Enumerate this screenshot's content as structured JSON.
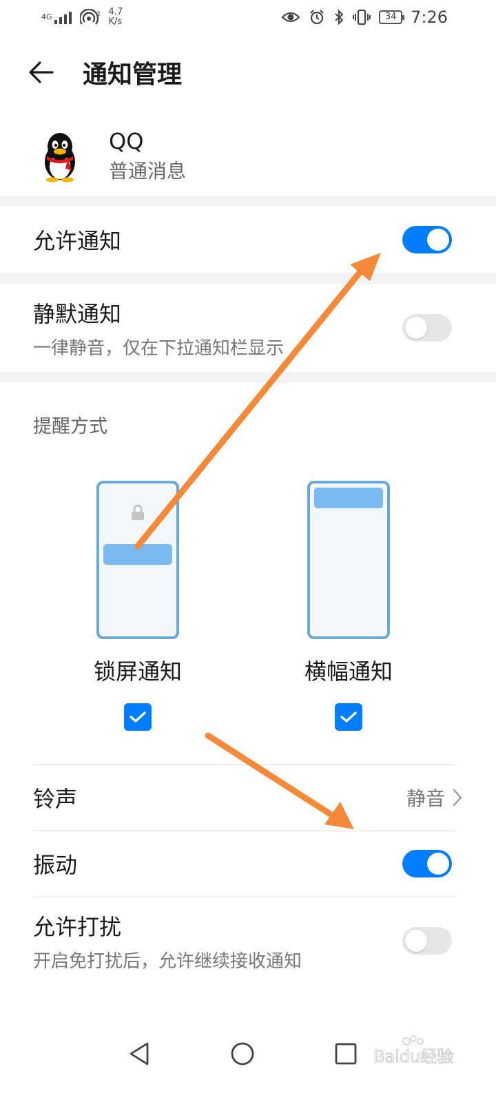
{
  "status_bar": {
    "network": "4G",
    "speed_value": "4.7",
    "speed_unit": "K/s",
    "battery": "34",
    "time": "7:26"
  },
  "header": {
    "title": "通知管理"
  },
  "app": {
    "name": "QQ",
    "category": "普通消息"
  },
  "allow_notifications": {
    "label": "允许通知",
    "enabled": true
  },
  "silent_notifications": {
    "label": "静默通知",
    "description": "一律静音，仅在下拉通知栏显示",
    "enabled": false
  },
  "reminder": {
    "section_label": "提醒方式",
    "options": [
      {
        "label": "锁屏通知",
        "checked": true
      },
      {
        "label": "横幅通知",
        "checked": true
      }
    ]
  },
  "ringtone": {
    "label": "铃声",
    "value": "静音"
  },
  "vibration": {
    "label": "振动",
    "enabled": true
  },
  "allow_disturb": {
    "label": "允许打扰",
    "description": "开启免打扰后，允许继续接收通知",
    "enabled": false
  },
  "watermark": {
    "text": "Baidu经验"
  },
  "colors": {
    "accent": "#007dff",
    "arrow": "#f5893a",
    "toggle_off": "#e6e6e6"
  },
  "icons": [
    "back-arrow-icon",
    "qq-penguin-icon",
    "lock-icon",
    "check-icon",
    "chevron-right-icon",
    "nav-back-icon",
    "nav-home-icon",
    "nav-recents-icon"
  ]
}
